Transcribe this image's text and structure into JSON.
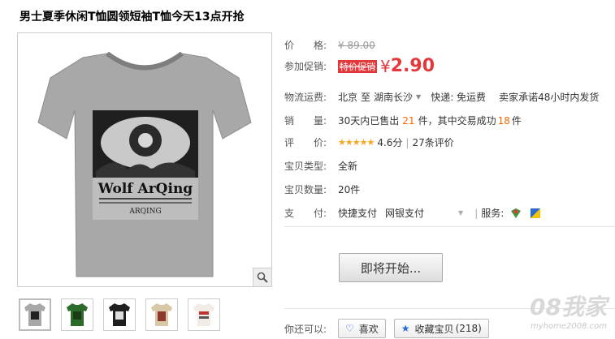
{
  "product": {
    "title": "男士夏季休闲T恤圆领短袖T恤今天13点开抢"
  },
  "price": {
    "label": "价　　格:",
    "original": "¥ 89.00",
    "promo_label": "参加促销:",
    "promo_tag": "特价促销",
    "yen": "¥",
    "current": "2.90"
  },
  "shipping": {
    "label": "物流运费:",
    "from": "北京",
    "to_sep": "至",
    "to": "湖南长沙",
    "express": "快递: 免运费",
    "promise": "卖家承诺48小时内发货"
  },
  "sales": {
    "label": "销　　量:",
    "prefix": "30天内已售出",
    "sold": "21",
    "mid": "件，其中交易成功",
    "success": "18",
    "suffix": "件"
  },
  "rating": {
    "label": "评　　价:",
    "stars": "★★★★★",
    "score": "4.6分",
    "count": "27条评价"
  },
  "condition": {
    "label": "宝贝类型:",
    "value": "全新"
  },
  "quantity": {
    "label": "宝贝数量:",
    "value": "20件"
  },
  "payment": {
    "label": "支　　付:",
    "methods": [
      "快捷支付",
      "网银支付"
    ],
    "service_label": "服务:"
  },
  "buy_button": "即将开始...",
  "share": {
    "label": "你还可以:",
    "like": "喜欢",
    "favorite": "收藏宝贝",
    "favorite_count": "(218)"
  },
  "shirt_print": {
    "brand": "Wolf ArQing",
    "small": "ARQING"
  },
  "watermark": {
    "main": "08我家",
    "site": "myhome2008.com"
  },
  "colors": {
    "accent": "#e4393c",
    "orange": "#ff6600",
    "star": "#f5a623"
  }
}
